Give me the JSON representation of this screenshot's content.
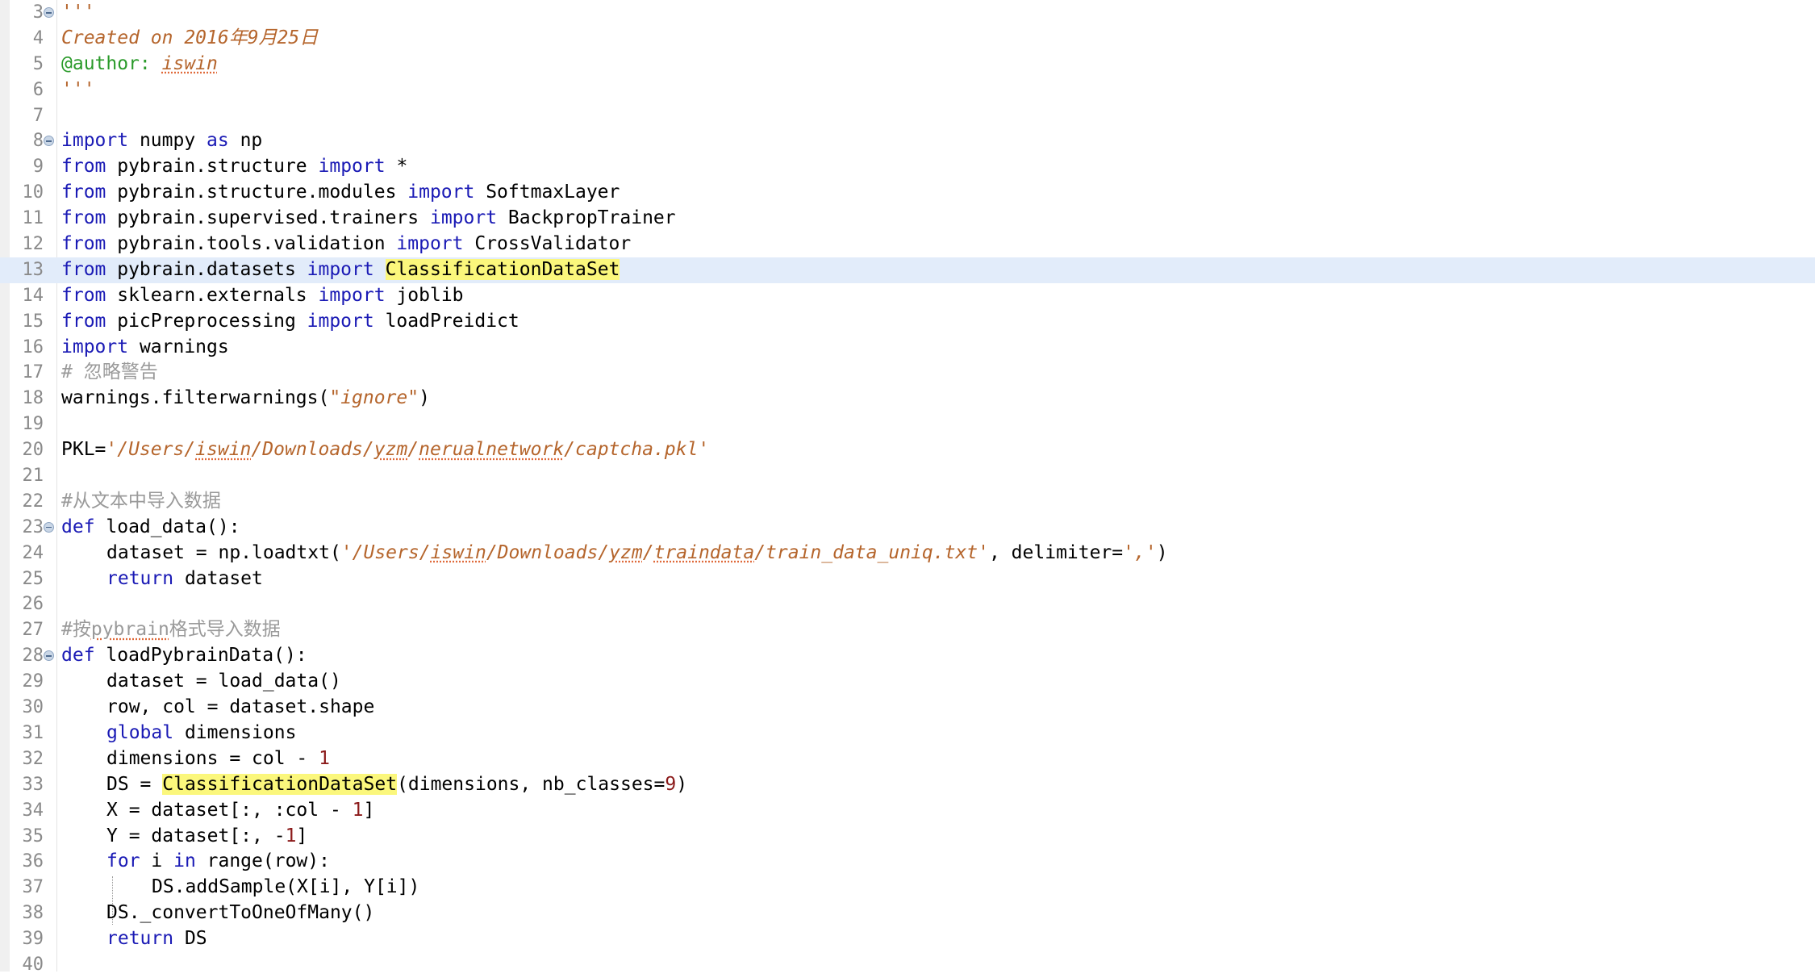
{
  "editor": {
    "current_line": 13,
    "lines": [
      {
        "n": "3",
        "fold": true,
        "tokens": [
          {
            "t": "'''",
            "c": "docstr"
          }
        ]
      },
      {
        "n": "4",
        "tokens": [
          {
            "t": "Created on 2016年9月25日",
            "c": "docstr"
          }
        ]
      },
      {
        "n": "5",
        "tokens": [
          {
            "t": "@author: ",
            "c": "deco"
          },
          {
            "t": "iswin",
            "c": "docstr spell"
          }
        ]
      },
      {
        "n": "6",
        "tokens": [
          {
            "t": "'''",
            "c": "docstr"
          }
        ]
      },
      {
        "n": "7",
        "tokens": []
      },
      {
        "n": "8",
        "fold": true,
        "tokens": [
          {
            "t": "import",
            "c": "kw"
          },
          {
            "t": " numpy "
          },
          {
            "t": "as",
            "c": "kw"
          },
          {
            "t": " np"
          }
        ]
      },
      {
        "n": "9",
        "tokens": [
          {
            "t": "from",
            "c": "kw"
          },
          {
            "t": " pybrain.structure "
          },
          {
            "t": "import",
            "c": "kw"
          },
          {
            "t": " *"
          }
        ]
      },
      {
        "n": "10",
        "tokens": [
          {
            "t": "from",
            "c": "kw"
          },
          {
            "t": " pybrain.structure.modules "
          },
          {
            "t": "import",
            "c": "kw"
          },
          {
            "t": " SoftmaxLayer"
          }
        ]
      },
      {
        "n": "11",
        "tokens": [
          {
            "t": "from",
            "c": "kw"
          },
          {
            "t": " pybrain.supervised.trainers "
          },
          {
            "t": "import",
            "c": "kw"
          },
          {
            "t": " BackpropTrainer"
          }
        ]
      },
      {
        "n": "12",
        "tokens": [
          {
            "t": "from",
            "c": "kw"
          },
          {
            "t": " pybrain.tools.validation "
          },
          {
            "t": "import",
            "c": "kw"
          },
          {
            "t": " CrossValidator"
          }
        ]
      },
      {
        "n": "13",
        "tokens": [
          {
            "t": "from",
            "c": "kw"
          },
          {
            "t": " pybrain.datasets "
          },
          {
            "t": "import",
            "c": "kw"
          },
          {
            "t": " "
          },
          {
            "t": "ClassificationDataSet",
            "c": "hl"
          }
        ]
      },
      {
        "n": "14",
        "tokens": [
          {
            "t": "from",
            "c": "kw"
          },
          {
            "t": " sklearn.externals "
          },
          {
            "t": "import",
            "c": "kw"
          },
          {
            "t": " joblib"
          }
        ]
      },
      {
        "n": "15",
        "tokens": [
          {
            "t": "from",
            "c": "kw"
          },
          {
            "t": " picPreprocessing "
          },
          {
            "t": "import",
            "c": "kw"
          },
          {
            "t": " loadPreidict"
          }
        ]
      },
      {
        "n": "16",
        "tokens": [
          {
            "t": "import",
            "c": "kw"
          },
          {
            "t": " warnings"
          }
        ]
      },
      {
        "n": "17",
        "tokens": [
          {
            "t": "# 忽略警告",
            "c": "cmt"
          }
        ]
      },
      {
        "n": "18",
        "tokens": [
          {
            "t": "warnings.filterwarnings("
          },
          {
            "t": "\"ignore\"",
            "c": "str"
          },
          {
            "t": ")"
          }
        ]
      },
      {
        "n": "19",
        "tokens": []
      },
      {
        "n": "20",
        "tokens": [
          {
            "t": "PKL="
          },
          {
            "t": "'/Users/",
            "c": "str"
          },
          {
            "t": "iswin",
            "c": "str spell"
          },
          {
            "t": "/Downloads/",
            "c": "str"
          },
          {
            "t": "yzm",
            "c": "str spell"
          },
          {
            "t": "/",
            "c": "str"
          },
          {
            "t": "nerualnetwork",
            "c": "str spell"
          },
          {
            "t": "/captcha.pkl'",
            "c": "str"
          }
        ]
      },
      {
        "n": "21",
        "tokens": []
      },
      {
        "n": "22",
        "tokens": [
          {
            "t": "#从文本中导入数据",
            "c": "cmt"
          }
        ]
      },
      {
        "n": "23",
        "fold": true,
        "tokens": [
          {
            "t": "def",
            "c": "kw"
          },
          {
            "t": " load_data():"
          }
        ]
      },
      {
        "n": "24",
        "indent": 1,
        "tokens": [
          {
            "t": "dataset = np.loadtxt("
          },
          {
            "t": "'/Users/",
            "c": "str"
          },
          {
            "t": "iswin",
            "c": "str spell"
          },
          {
            "t": "/Downloads/",
            "c": "str"
          },
          {
            "t": "yzm",
            "c": "str spell"
          },
          {
            "t": "/",
            "c": "str"
          },
          {
            "t": "traindata",
            "c": "str spell"
          },
          {
            "t": "/train_data_uniq.txt'",
            "c": "str"
          },
          {
            "t": ", delimiter="
          },
          {
            "t": "','",
            "c": "str"
          },
          {
            "t": ")"
          }
        ]
      },
      {
        "n": "25",
        "indent": 1,
        "tokens": [
          {
            "t": "return",
            "c": "kw"
          },
          {
            "t": " dataset"
          }
        ]
      },
      {
        "n": "26",
        "tokens": []
      },
      {
        "n": "27",
        "tokens": [
          {
            "t": "#按",
            "c": "cmt"
          },
          {
            "t": "pybrain",
            "c": "cmt spell"
          },
          {
            "t": "格式导入数据",
            "c": "cmt"
          }
        ]
      },
      {
        "n": "28",
        "fold": true,
        "tokens": [
          {
            "t": "def",
            "c": "kw"
          },
          {
            "t": " loadPybrainData():"
          }
        ]
      },
      {
        "n": "29",
        "indent": 1,
        "tokens": [
          {
            "t": "dataset = load_data()"
          }
        ]
      },
      {
        "n": "30",
        "indent": 1,
        "tokens": [
          {
            "t": "row, col = dataset.shape"
          }
        ]
      },
      {
        "n": "31",
        "indent": 1,
        "tokens": [
          {
            "t": "global",
            "c": "kw"
          },
          {
            "t": " dimensions"
          }
        ]
      },
      {
        "n": "32",
        "indent": 1,
        "tokens": [
          {
            "t": "dimensions = col - "
          },
          {
            "t": "1",
            "c": "num"
          }
        ]
      },
      {
        "n": "33",
        "indent": 1,
        "tokens": [
          {
            "t": "DS = "
          },
          {
            "t": "ClassificationDataSet",
            "c": "hl"
          },
          {
            "t": "(dimensions, nb_classes="
          },
          {
            "t": "9",
            "c": "num"
          },
          {
            "t": ")"
          }
        ]
      },
      {
        "n": "34",
        "indent": 1,
        "tokens": [
          {
            "t": "X = dataset[:, :col - "
          },
          {
            "t": "1",
            "c": "num"
          },
          {
            "t": "]"
          }
        ]
      },
      {
        "n": "35",
        "indent": 1,
        "tokens": [
          {
            "t": "Y = dataset[:, -"
          },
          {
            "t": "1",
            "c": "num"
          },
          {
            "t": "]"
          }
        ]
      },
      {
        "n": "36",
        "indent": 1,
        "tokens": [
          {
            "t": "for",
            "c": "kw"
          },
          {
            "t": " i "
          },
          {
            "t": "in",
            "c": "kw"
          },
          {
            "t": " range(row):"
          }
        ]
      },
      {
        "n": "37",
        "indent": 2,
        "guide": true,
        "tokens": [
          {
            "t": "DS.addSample(X[i], Y[i])"
          }
        ]
      },
      {
        "n": "38",
        "indent": 1,
        "tokens": [
          {
            "t": "DS._convertToOneOfMany()"
          }
        ]
      },
      {
        "n": "39",
        "indent": 1,
        "tokens": [
          {
            "t": "return",
            "c": "kw"
          },
          {
            "t": " DS"
          }
        ]
      },
      {
        "n": "40",
        "tokens": []
      }
    ]
  }
}
